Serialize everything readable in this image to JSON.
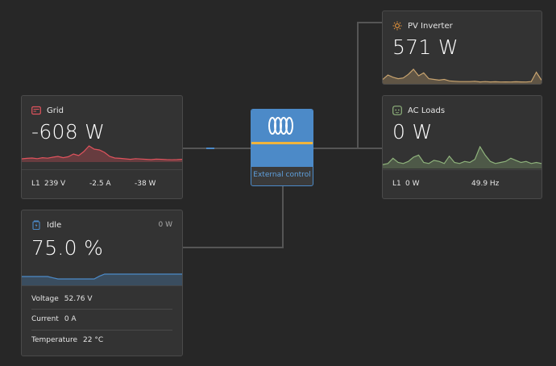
{
  "colors": {
    "grid": "#e0535d",
    "pv": "#c9a46f",
    "loads": "#8fb37c",
    "battery": "#4c8ac8",
    "inverter_blue": "#4c8ac8",
    "inverter_stripe": "#f0b43c"
  },
  "grid": {
    "title": "Grid",
    "icon": "grid-meter-icon",
    "value": "-608 W",
    "phase": "L1",
    "voltage": "239 V",
    "current": "-2.5 A",
    "power": "-38 W",
    "history": [
      0.15,
      0.18,
      0.2,
      0.16,
      0.22,
      0.19,
      0.25,
      0.3,
      0.22,
      0.28,
      0.45,
      0.35,
      0.6,
      0.95,
      0.75,
      0.7,
      0.55,
      0.3,
      0.2,
      0.18,
      0.15,
      0.12,
      0.16,
      0.14,
      0.12,
      0.1,
      0.13,
      0.12,
      0.1,
      0.09,
      0.1,
      0.12
    ]
  },
  "inverter": {
    "label": "External control",
    "icon": "victron-logo-icon"
  },
  "pv": {
    "title": "PV Inverter",
    "icon": "sun-icon",
    "value": "571 W",
    "history": [
      0.25,
      0.55,
      0.4,
      0.3,
      0.35,
      0.6,
      0.95,
      0.5,
      0.7,
      0.3,
      0.25,
      0.2,
      0.25,
      0.15,
      0.12,
      0.1,
      0.1,
      0.1,
      0.12,
      0.08,
      0.1,
      0.08,
      0.09,
      0.07,
      0.08,
      0.07,
      0.09,
      0.08,
      0.07,
      0.1,
      0.75,
      0.2
    ]
  },
  "loads": {
    "title": "AC Loads",
    "icon": "outlet-icon",
    "value": "0 W",
    "phase": "L1",
    "power": "0 W",
    "frequency": "49.9 Hz",
    "history": [
      0.15,
      0.2,
      0.45,
      0.25,
      0.2,
      0.3,
      0.5,
      0.6,
      0.25,
      0.2,
      0.35,
      0.3,
      0.2,
      0.55,
      0.25,
      0.2,
      0.3,
      0.25,
      0.4,
      1.0,
      0.6,
      0.3,
      0.2,
      0.25,
      0.3,
      0.45,
      0.35,
      0.25,
      0.3,
      0.2,
      0.25,
      0.2
    ]
  },
  "battery": {
    "title": "Idle",
    "icon": "battery-icon",
    "power": "0 W",
    "value": "75.0 %",
    "history": [
      0.5,
      0.5,
      0.5,
      0.5,
      0.5,
      0.5,
      0.42,
      0.35,
      0.35,
      0.35,
      0.35,
      0.35,
      0.35,
      0.35,
      0.35,
      0.52,
      0.65,
      0.65,
      0.65,
      0.65,
      0.65,
      0.65,
      0.65,
      0.65,
      0.65,
      0.65,
      0.65,
      0.65,
      0.65,
      0.65,
      0.65,
      0.65
    ],
    "voltage_label": "Voltage",
    "voltage": "52.76 V",
    "current_label": "Current",
    "current": "0 A",
    "temperature_label": "Temperature",
    "temperature": "22 °C"
  }
}
